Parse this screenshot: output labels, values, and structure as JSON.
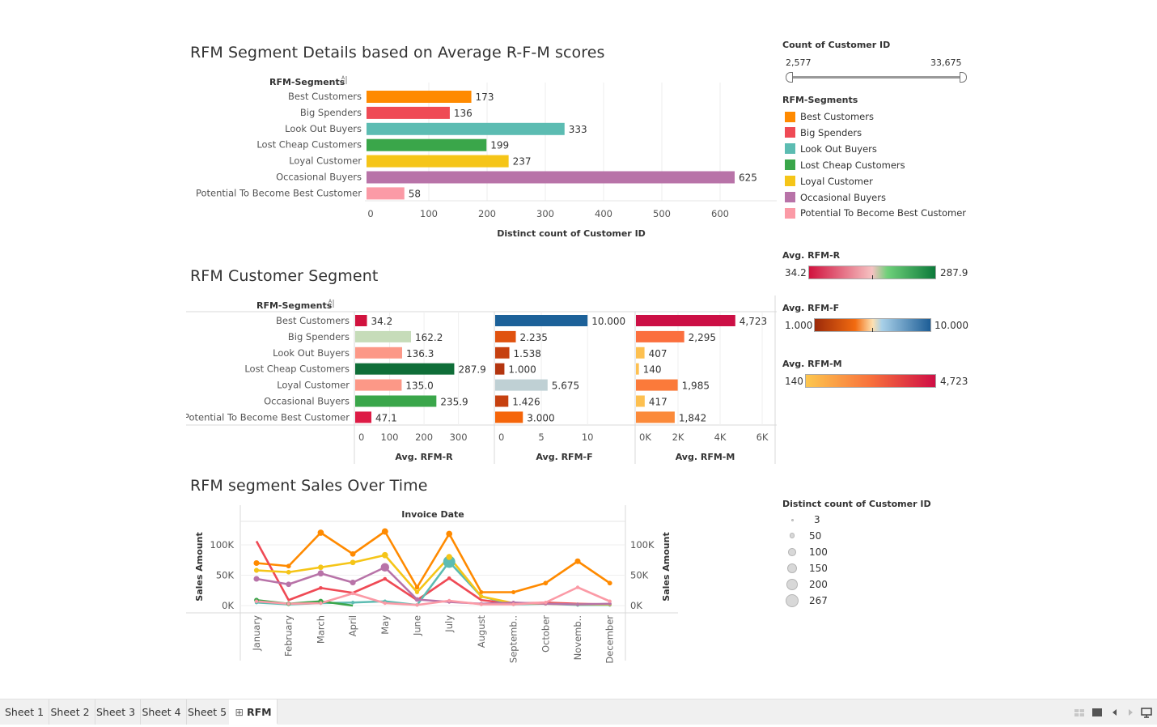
{
  "sections": {
    "seg_details_title": "RFM Segment Details based on Average R-F-M scores",
    "customer_segment_title": "RFM Customer Segment",
    "sales_time_title": "RFM segment Sales Over Time"
  },
  "colors": {
    "Best Customers": "#ff8a00",
    "Big Spenders": "#ef4a55",
    "Look Out Buyers": "#5cbcb2",
    "Lost Cheap Customers": "#3aa64a",
    "Loyal Customer": "#f5c518",
    "Occasional Buyers": "#b873a8",
    "Potential To Become Best Customer": "#fb9aa6"
  },
  "chart_data": [
    {
      "type": "bar",
      "title": "RFM Segment Details based on Average R-F-M scores",
      "row_header": "RFM-Segments",
      "sort_icon": "sort-az-icon",
      "categories": [
        "Best Customers",
        "Big Spenders",
        "Look Out Buyers",
        "Lost Cheap Customers",
        "Loyal Customer",
        "Occasional Buyers",
        "Potential To Become Best Customer"
      ],
      "values": [
        173,
        136,
        333,
        199,
        237,
        625,
        58
      ],
      "xlabel": "Distinct count of Customer ID",
      "xticks": [
        "0",
        "100",
        "200",
        "300",
        "400",
        "500",
        "600"
      ],
      "xlim": [
        0,
        700
      ],
      "grid": true
    },
    {
      "type": "bar",
      "title": "RFM Customer Segment",
      "row_header": "RFM-Segments",
      "categories": [
        "Best Customers",
        "Big Spenders",
        "Look Out Buyers",
        "Lost Cheap Customers",
        "Loyal Customer",
        "Occasional Buyers",
        "Potential To Become Best Customer"
      ],
      "panels": [
        {
          "xlabel": "Avg. RFM-R",
          "values": [
            34.2,
            162.2,
            136.3,
            287.9,
            135.0,
            235.9,
            47.1
          ],
          "labels": [
            "34.2",
            "162.2",
            "136.3",
            "287.9",
            "135.0",
            "235.9",
            "47.1"
          ],
          "xticks": [
            "0",
            "100",
            "200",
            "300"
          ],
          "tick_values": [
            0,
            100,
            200,
            300
          ],
          "xlim": [
            0,
            395
          ],
          "colors": [
            "#d1123e",
            "#c6dcb9",
            "#fc9887",
            "#0f6e38",
            "#fc9887",
            "#3aa64a",
            "#dd1b45"
          ]
        },
        {
          "xlabel": "Avg. RFM-F",
          "values": [
            10.0,
            2.235,
            1.538,
            1.0,
            5.675,
            1.426,
            3.0
          ],
          "labels": [
            "10.000",
            "2.235",
            "1.538",
            "1.000",
            "5.675",
            "1.426",
            "3.000"
          ],
          "xticks": [
            "0",
            "5",
            "10"
          ],
          "tick_values": [
            0,
            5,
            10
          ],
          "xlim": [
            0,
            14.8
          ],
          "colors": [
            "#1c6199",
            "#e0520f",
            "#c6400f",
            "#b3350f",
            "#bfd0d4",
            "#c6400f",
            "#f5650a"
          ]
        },
        {
          "xlabel": "Avg. RFM-M",
          "values": [
            4723,
            2295,
            407,
            140,
            1985,
            417,
            1842
          ],
          "labels": [
            "4,723",
            "2,295",
            "407",
            "140",
            "1,985",
            "417",
            "1,842"
          ],
          "xticks": [
            "0K",
            "2K",
            "4K",
            "6K"
          ],
          "tick_values": [
            0,
            2000,
            4000,
            6000
          ],
          "xlim": [
            0,
            6500
          ],
          "colors": [
            "#cc0f45",
            "#fb6f3e",
            "#fdc050",
            "#fdc050",
            "#fb7a3a",
            "#fdc050",
            "#fb8a3a"
          ]
        }
      ]
    },
    {
      "type": "line",
      "title": "RFM segment Sales Over Time",
      "top_label": "Invoice Date",
      "ylabel": "Sales Amount",
      "yticks": [
        "0K",
        "50K",
        "100K"
      ],
      "tick_values": [
        0,
        50000,
        100000
      ],
      "ylim": [
        -2000,
        125000
      ],
      "x": [
        "January",
        "February",
        "March",
        "April",
        "May",
        "June",
        "July",
        "August",
        "Septemb..",
        "October",
        "Novemb..",
        "December"
      ],
      "series": [
        {
          "name": "Best Customers",
          "values": [
            70000,
            65000,
            120000,
            85000,
            122000,
            30000,
            118000,
            22000,
            22000,
            37000,
            73000,
            37000
          ],
          "sizes": [
            60,
            40,
            70,
            55,
            75,
            35,
            70,
            30,
            30,
            40,
            60,
            40
          ]
        },
        {
          "name": "Big Spenders",
          "values": [
            106000,
            9000,
            29000,
            21000,
            44000,
            9000,
            45000,
            9000,
            3000,
            5000,
            3000,
            2000
          ],
          "sizes": [
            0,
            0,
            25,
            0,
            25,
            0,
            25,
            0,
            0,
            0,
            0,
            0
          ]
        },
        {
          "name": "Look Out Buyers",
          "values": [
            5000,
            2000,
            4000,
            5000,
            7000,
            1000,
            72000,
            15000,
            2000,
            3000,
            1000,
            1000
          ],
          "sizes": [
            15,
            10,
            15,
            15,
            20,
            10,
            267,
            30,
            10,
            10,
            10,
            10
          ]
        },
        {
          "name": "Lost Cheap Customers",
          "values": [
            9000,
            3000,
            7000,
            0,
            null,
            null,
            null,
            null,
            null,
            null,
            null,
            null
          ],
          "sizes": [
            40,
            35,
            45,
            0,
            0,
            0,
            0,
            0,
            0,
            0,
            0,
            0
          ]
        },
        {
          "name": "Loyal Customer",
          "values": [
            58000,
            55000,
            63000,
            71000,
            83000,
            22000,
            80000,
            15000,
            4000,
            3000,
            2000,
            2000
          ],
          "sizes": [
            45,
            40,
            55,
            55,
            70,
            30,
            65,
            30,
            10,
            10,
            10,
            10
          ]
        },
        {
          "name": "Occasional Buyers",
          "values": [
            44000,
            35000,
            53000,
            38000,
            63000,
            10000,
            6000,
            3000,
            5000,
            3000,
            2000,
            3000
          ],
          "sizes": [
            60,
            55,
            70,
            60,
            130,
            40,
            20,
            10,
            10,
            10,
            10,
            10
          ]
        },
        {
          "name": "Potential To Become Best Customer",
          "values": [
            7000,
            3000,
            4000,
            20000,
            4000,
            1000,
            8000,
            2000,
            2000,
            5000,
            30000,
            7000
          ],
          "sizes": [
            10,
            10,
            10,
            10,
            10,
            10,
            10,
            10,
            10,
            10,
            10,
            10
          ]
        }
      ]
    }
  ],
  "filters": {
    "count_title": "Count of Customer ID",
    "count_min": "2,577",
    "count_max": "33,675",
    "seg_legend_title": "RFM-Segments",
    "seg_legend": [
      "Best Customers",
      "Big Spenders",
      "Look Out Buyers",
      "Lost Cheap Customers",
      "Loyal Customer",
      "Occasional Buyers",
      "Potential To Become Best Customer"
    ],
    "r_title": "Avg. RFM-R",
    "r_min": "34.2",
    "r_max": "287.9",
    "f_title": "Avg. RFM-F",
    "f_min": "1.000",
    "f_max": "10.000",
    "m_title": "Avg. RFM-M",
    "m_min": "140",
    "m_max": "4,723",
    "size_title": "Distinct count of Customer ID",
    "size_items": [
      "3",
      "50",
      "100",
      "150",
      "200",
      "267"
    ]
  },
  "tabs": [
    "Sheet 1",
    "Sheet 2",
    "Sheet 3",
    "Sheet 4",
    "Sheet 5",
    "RFM"
  ],
  "active_tab": "RFM",
  "nav_icons": [
    "grid-view-icon",
    "single-view-icon",
    "prev-arrow-icon",
    "next-arrow-icon",
    "presentation-icon"
  ]
}
